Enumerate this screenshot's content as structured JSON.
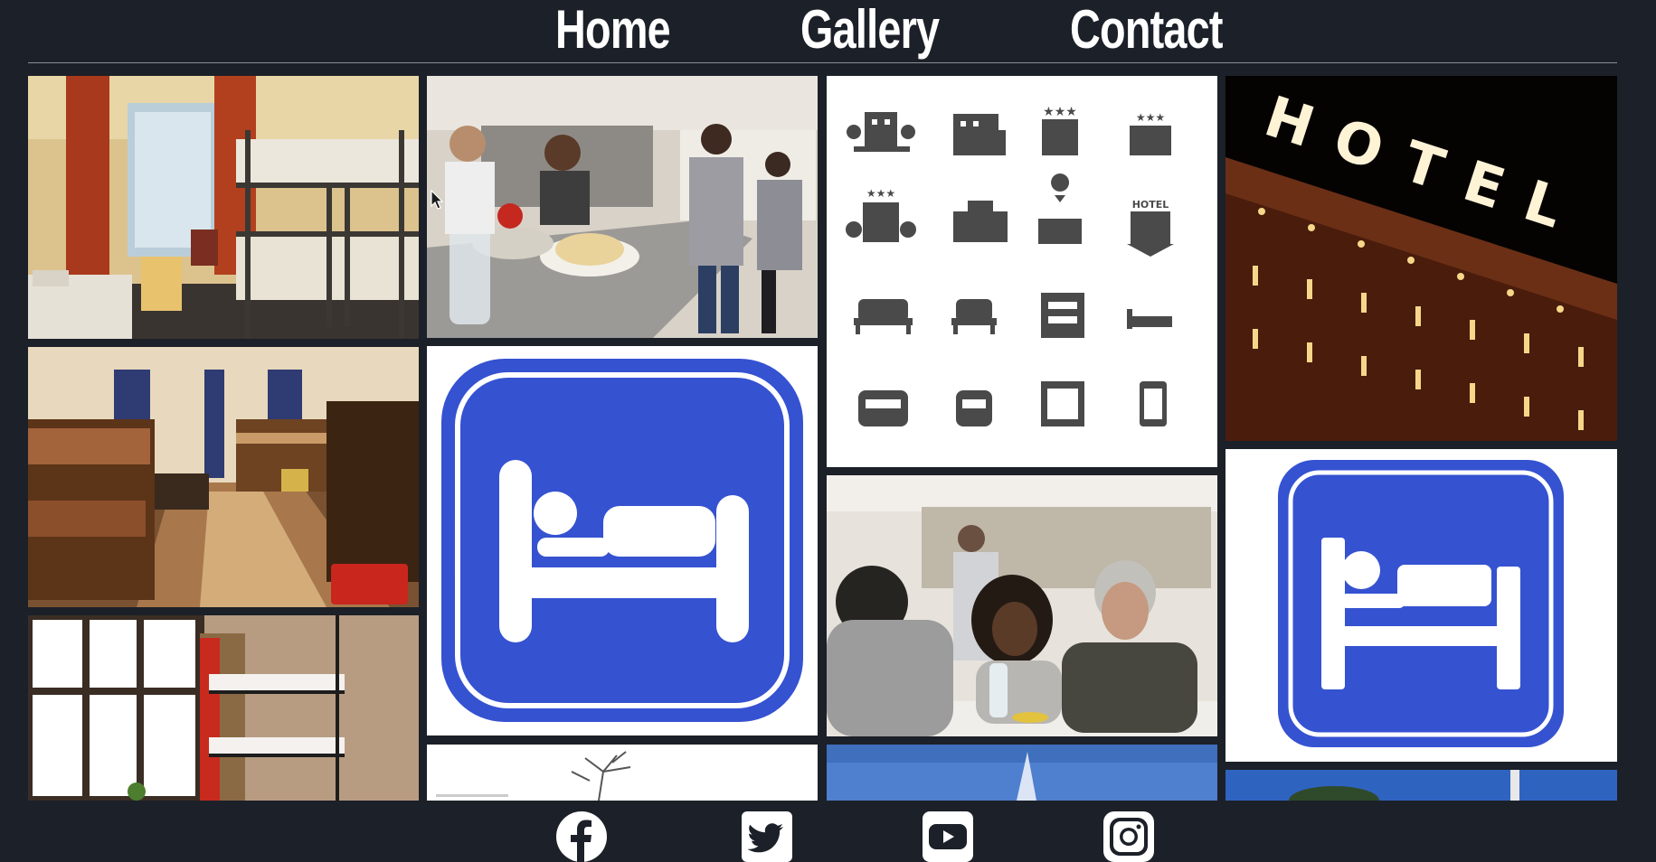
{
  "nav": {
    "items": [
      {
        "label": "Home"
      },
      {
        "label": "Gallery"
      },
      {
        "label": "Contact"
      }
    ]
  },
  "gallery": {
    "tiles": [
      {
        "icon": "bunk-bed-room-photo"
      },
      {
        "icon": "food-service-line-photo"
      },
      {
        "icon": "hotel-icon-set"
      },
      {
        "icon": "hotel-sign-night-photo",
        "sign_text": "HOTEL"
      },
      {
        "icon": "dormitory-room-photo"
      },
      {
        "icon": "blue-bed-sign-icon"
      },
      {
        "icon": "people-at-table-photo"
      },
      {
        "icon": "blue-bed-sign-icon"
      },
      {
        "icon": "window-bunk-room-photo"
      },
      {
        "icon": "tree-sketch-image"
      },
      {
        "icon": "blue-sky-photo"
      },
      {
        "icon": "sky-trees-photo"
      }
    ],
    "hotel_badge_text": "HOTEL"
  },
  "colors": {
    "background": "#1c2028",
    "accent_blue": "#3552d1",
    "text": "#ffffff"
  },
  "footer": {
    "social": [
      {
        "icon": "facebook-icon"
      },
      {
        "icon": "twitter-icon"
      },
      {
        "icon": "youtube-icon"
      },
      {
        "icon": "instagram-icon"
      }
    ]
  }
}
